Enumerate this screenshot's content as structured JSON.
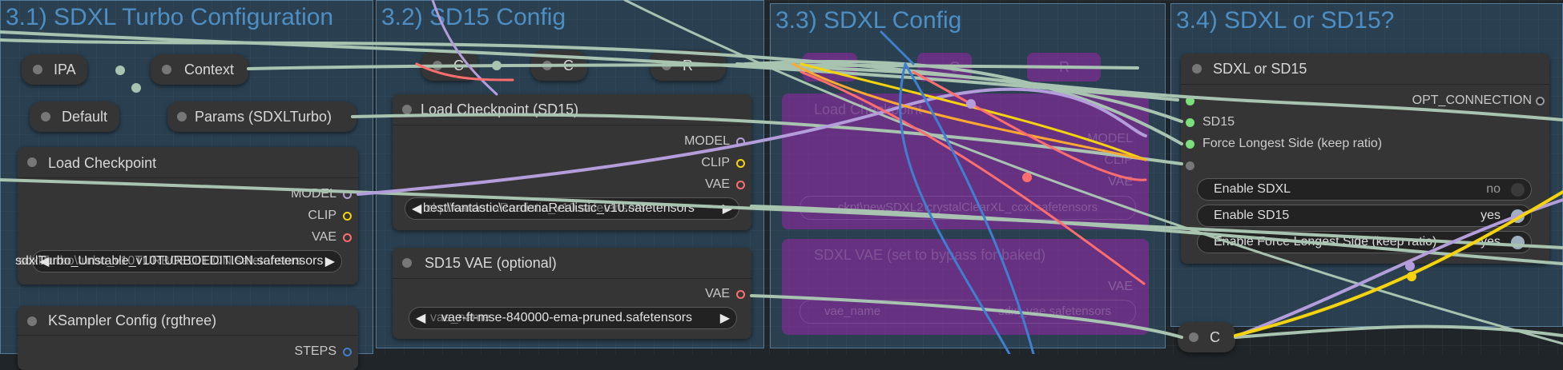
{
  "groups": {
    "sdxl_turbo": {
      "title": "3.1) SDXL Turbo Configuration"
    },
    "sd15": {
      "title": "3.2) SD15 Config"
    },
    "sdxl": {
      "title": "3.3) SDXL Config"
    },
    "switch": {
      "title": "3.4) SDXL or SD15?"
    }
  },
  "reroutes": {
    "ipa": "IPA",
    "context": "Context",
    "default": "Default",
    "params": "Params (SDXLTurbo)",
    "c1": "C",
    "c2": "C",
    "r1": "R",
    "bp_c": "C",
    "bp_c2": "C",
    "bp_r": "R",
    "c_bottom": "C"
  },
  "load_checkpoint_turbo": {
    "title": "Load Checkpoint",
    "outputs": [
      "MODEL",
      "CLIP",
      "VAE"
    ],
    "ckpt_value": "sdxlTurbo_Unstable_v10TURBOEDITION.safetensors",
    "ckpt_overlap": "sdxlTurbo\\turbo_v10TURBOEDITION.safetensors"
  },
  "ksampler": {
    "title": "KSampler Config (rgthree)",
    "output": "STEPS"
  },
  "load_checkpoint_sd15": {
    "title": "Load Checkpoint (SD15)",
    "outputs": [
      "MODEL",
      "CLIP",
      "VAE"
    ],
    "ckpt_value": "best\\fantastic\\cardenaRealistic_v10.safetensors",
    "ckpt_overlap": "ckpt\\cardenaRealistic_v10.safetensors"
  },
  "sd15_vae": {
    "title": "SD15 VAE (optional)",
    "output": "VAE",
    "vae_value": "vae-ft-mse-840000-ema-pruned.safetensors",
    "vae_label": "vae_name"
  },
  "sdxl_bypassed": {
    "ckpt_title": "Load Checkpoint",
    "outputs": [
      "MODEL",
      "CLIP",
      "VAE"
    ],
    "ckpt_value": "ckpt\\newSDXL2\\crystalClearXL_ccxl.safetensors",
    "vae_title": "SDXL VAE (set to bypass for baked)",
    "vae_output": "VAE",
    "vae_label": "vae_name",
    "vae_value": "sdxl_vae.safetensors"
  },
  "switch_node": {
    "title": "SDXL or SD15",
    "output": "OPT_CONNECTION",
    "inputs": [
      "",
      "SD15",
      "Force Longest Side (keep ratio)",
      ""
    ],
    "toggles": [
      {
        "label": "Enable SDXL",
        "state": "no",
        "on": false
      },
      {
        "label": "Enable SD15",
        "state": "yes",
        "on": true
      },
      {
        "label": "Enable Force Longest Side (keep ratio)",
        "state": "yes",
        "on": true
      }
    ]
  },
  "colors": {
    "model": "#b39ddb",
    "clip": "#f5d30d",
    "vae": "#ff6e6e",
    "conditioning": "#ffa931",
    "link_default": "#a8c4b0",
    "link_blue": "#3f7fd0",
    "socket_green": "#7be07b",
    "bypass": "#8c28a0"
  }
}
